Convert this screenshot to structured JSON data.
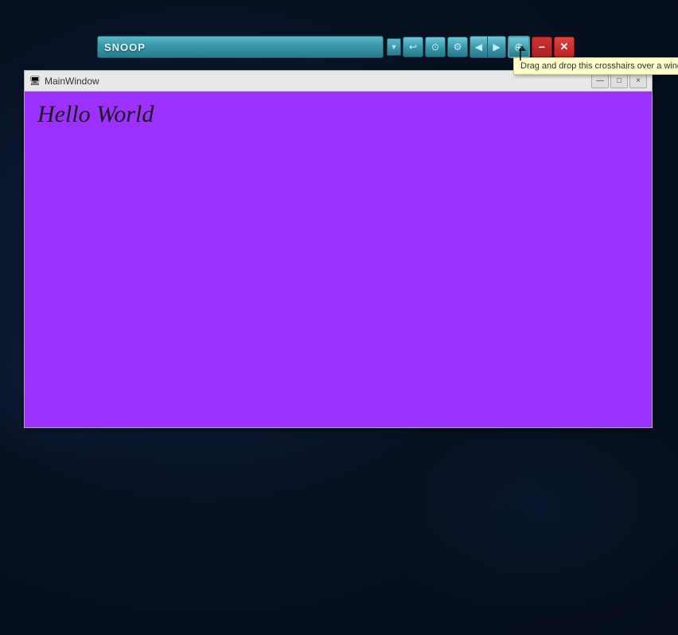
{
  "desktop": {
    "background_color": "#0a1628"
  },
  "toolbar": {
    "snoop_label": "SNOOP",
    "dropdown_arrow": "▼",
    "tooltip_text": "Drag and drop this crosshairs over a window to inspect it"
  },
  "window": {
    "title": "MainWindow",
    "icon": "🖥",
    "content_text": "Hello World",
    "content_background": "#9b30ff",
    "minimize_label": "—",
    "maximize_label": "□",
    "close_label": "×"
  },
  "buttons": {
    "globe_icon": "🌐",
    "magnify_icon": "🔍",
    "settings_icon": "⚙",
    "nav_prev": "◀",
    "nav_next": "▶",
    "crosshair_icon": "⊕",
    "minus_icon": "−",
    "close_icon": "✕"
  }
}
